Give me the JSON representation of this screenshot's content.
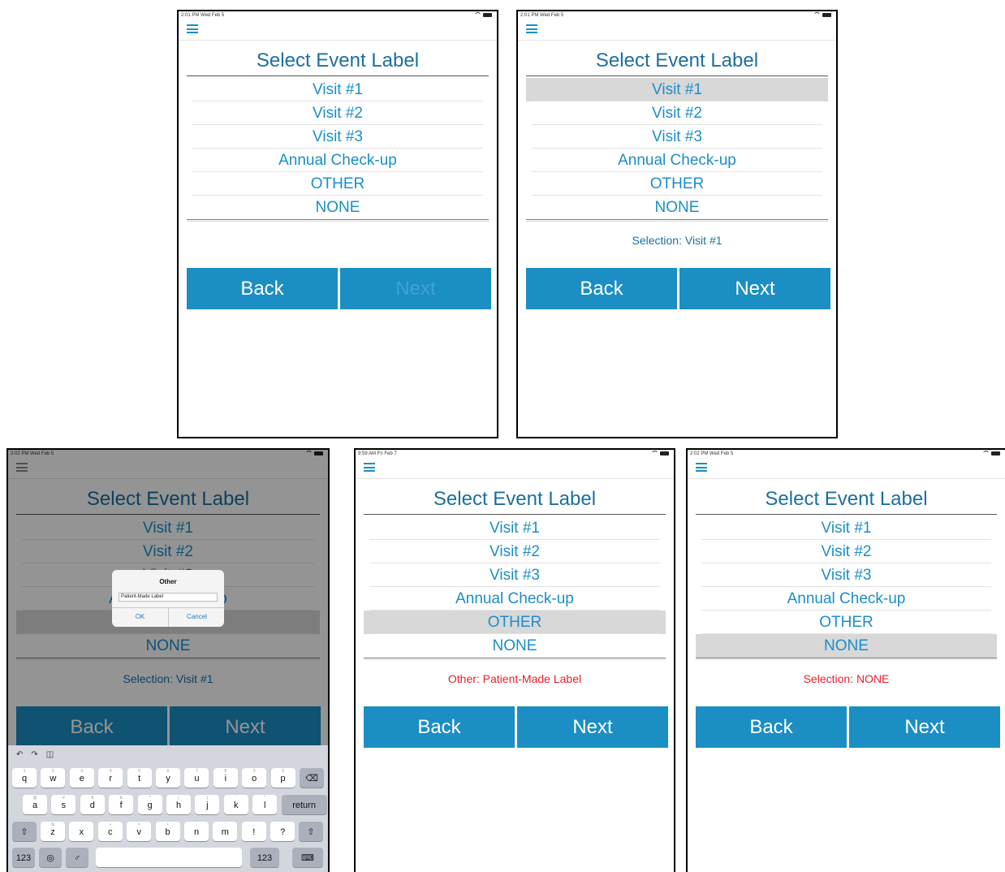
{
  "screens": [
    {
      "status": "2:01 PM  Wed Feb 5",
      "title": "Select Event Label",
      "items": [
        "Visit #1",
        "Visit #2",
        "Visit #3",
        "Annual Check-up",
        "OTHER",
        "NONE"
      ],
      "selected": -1,
      "selection_text": "",
      "back_label": "Back",
      "next_label": "Next",
      "next_enabled": false
    },
    {
      "status": "2:01 PM  Wed Feb 5",
      "title": "Select Event Label",
      "items": [
        "Visit #1",
        "Visit #2",
        "Visit #3",
        "Annual Check-up",
        "OTHER",
        "NONE"
      ],
      "selected": 0,
      "selection_text": "Selection:  Visit #1",
      "back_label": "Back",
      "next_label": "Next",
      "next_enabled": true
    },
    {
      "status": "2:02 PM  Wed Feb 5",
      "title": "Select Event Label",
      "items": [
        "Visit #1",
        "Visit #2",
        "Visit #3",
        "Annual Check-up",
        "OTHER",
        "NONE"
      ],
      "selected": 4,
      "selection_text": "Selection:  Visit #1",
      "back_label": "Back",
      "next_label": "Next",
      "next_enabled": true,
      "dialog": {
        "title": "Other",
        "input_value": "Patient-Made Label",
        "ok_label": "OK",
        "cancel_label": "Cancel"
      },
      "keyboard": {
        "row1": [
          "q",
          "w",
          "e",
          "r",
          "t",
          "y",
          "u",
          "i",
          "o",
          "p"
        ],
        "row1_hints": [
          "1",
          "2",
          "3",
          "4",
          "5",
          "6",
          "7",
          "8",
          "9",
          "0"
        ],
        "row2": [
          "a",
          "s",
          "d",
          "f",
          "g",
          "h",
          "j",
          "k",
          "l"
        ],
        "row2_hints": [
          "@",
          "#",
          "$",
          "&",
          "*",
          "(",
          ")",
          "'",
          "\""
        ],
        "row3": [
          "z",
          "x",
          "c",
          "v",
          "b",
          "n",
          "m",
          "!",
          "?"
        ],
        "row3_hints": [
          "%",
          "-",
          "+",
          "=",
          "/",
          ";",
          ":",
          ",",
          "."
        ],
        "return_label": "return",
        "numbers_label": "123"
      }
    },
    {
      "status": "9:59 AM  Fri Feb 7",
      "title": "Select Event Label",
      "items": [
        "Visit #1",
        "Visit #2",
        "Visit #3",
        "Annual Check-up",
        "OTHER",
        "NONE"
      ],
      "selected": 4,
      "selection_text": "Other:  Patient-Made Label",
      "selection_color": "red",
      "back_label": "Back",
      "next_label": "Next",
      "next_enabled": true
    },
    {
      "status": "2:02 PM  Wed Feb 5",
      "title": "Select Event Label",
      "items": [
        "Visit #1",
        "Visit #2",
        "Visit #3",
        "Annual Check-up",
        "OTHER",
        "NONE"
      ],
      "selected": 5,
      "selection_text": "Selection:  NONE",
      "selection_color": "red",
      "back_label": "Back",
      "next_label": "Next",
      "next_enabled": true
    }
  ],
  "colors": {
    "accent": "#1b8ec4",
    "title": "#1b6fa0",
    "selected_row": "#d8d8d8",
    "error_text": "#e8202a"
  },
  "icons": {
    "menu": "hamburger-menu-icon",
    "wifi": "wifi-icon",
    "battery": "battery-icon"
  }
}
